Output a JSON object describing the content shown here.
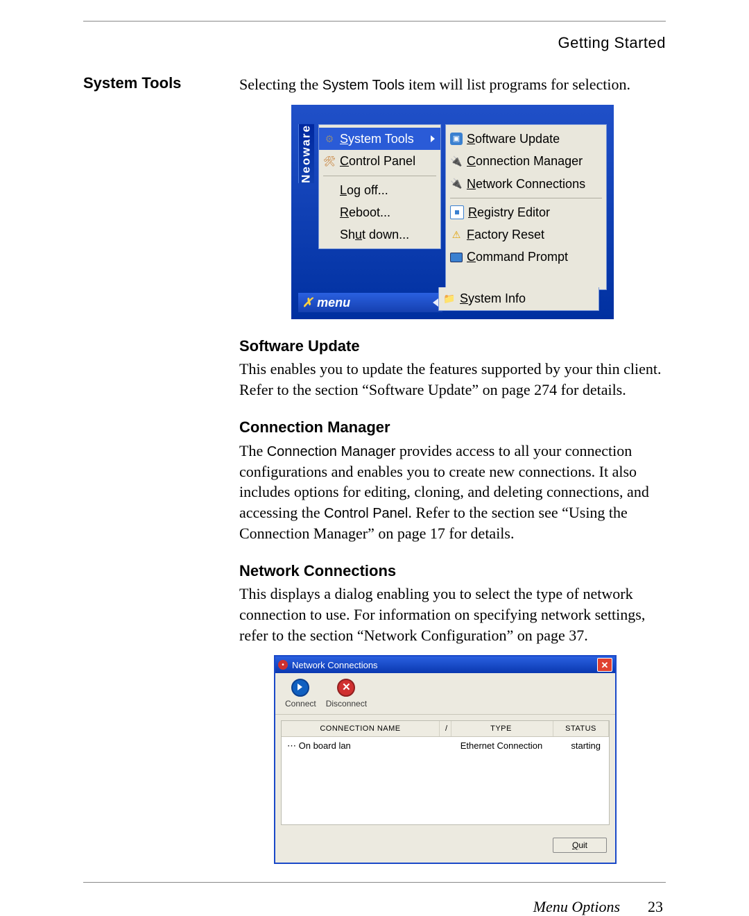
{
  "runningHead": "Getting Started",
  "marginHeading": "System Tools",
  "intro_pre": "Selecting the ",
  "intro_code": "System Tools",
  "intro_post": " item will list programs for selection.",
  "menu": {
    "brand": "Neoware",
    "bar_label": "menu",
    "left": {
      "system_tools": "System Tools",
      "control_panel": "Control Panel",
      "log_off": "Log off...",
      "reboot": "Reboot...",
      "shut_down": "Shut down..."
    },
    "right": {
      "software_update": "Software Update",
      "connection_manager": "Connection Manager",
      "network_connections": "Network Connections",
      "registry_editor": "Registry Editor",
      "factory_reset": "Factory Reset",
      "command_prompt": "Command Prompt",
      "system_info": "System Info"
    }
  },
  "sections": {
    "software_update": {
      "title": "Software Update",
      "body": "This enables you to update the features supported by your thin client. Refer to the section “Software Update” on page 274 for details."
    },
    "connection_manager": {
      "title": "Connection Manager",
      "body_pre": "The ",
      "body_code1": "Connection Manager",
      "body_mid": " provides access to all your connection configurations and enables you to create new connections. It also includes options for editing, cloning, and deleting connections, and accessing the ",
      "body_code2": "Control Panel",
      "body_post": ". Refer to the section see “Using the Connection Manager” on page 17 for details."
    },
    "network_connections": {
      "title": "Network Connections",
      "body": "This displays a dialog enabling you to select the type of network connection to use. For information on specifying network settings, refer to the section “Network Configuration” on page 37."
    }
  },
  "dialog": {
    "title": "Network Connections",
    "toolbar": {
      "connect": "Connect",
      "disconnect": "Disconnect"
    },
    "columns": {
      "name": "CONNECTION NAME",
      "type": "TYPE",
      "status": "STATUS"
    },
    "row": {
      "name": "On board lan",
      "type": "Ethernet Connection",
      "status": "starting"
    },
    "quit": "Quit"
  },
  "footer": {
    "section": "Menu Options",
    "page": "23"
  }
}
